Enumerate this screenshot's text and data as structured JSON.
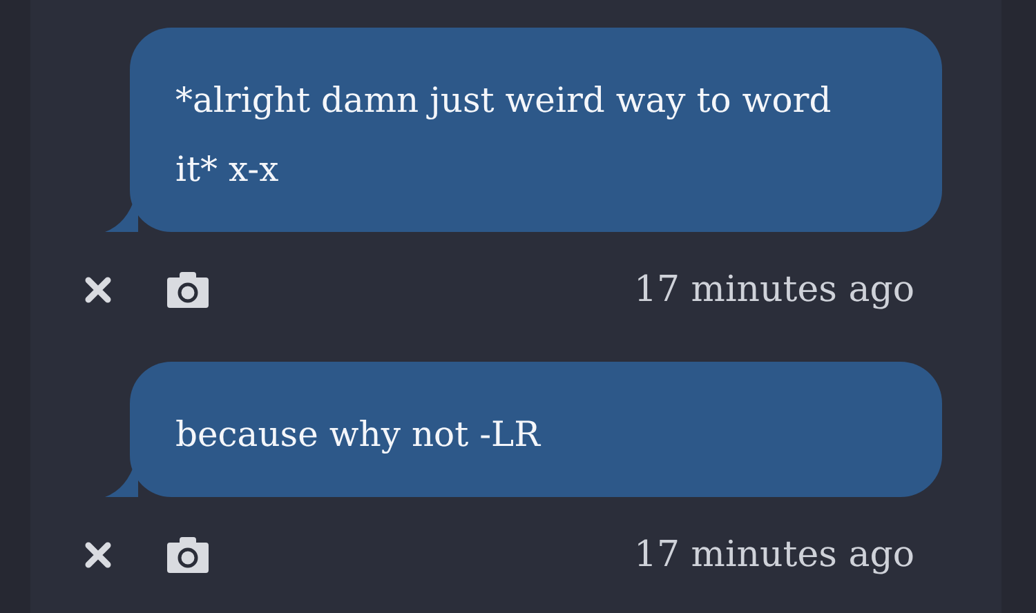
{
  "messages": [
    {
      "text": "*alright damn just weird way to word it* x-x",
      "time": "17 minutes ago"
    },
    {
      "text": "because why not -LR",
      "time": "17 minutes ago"
    }
  ]
}
